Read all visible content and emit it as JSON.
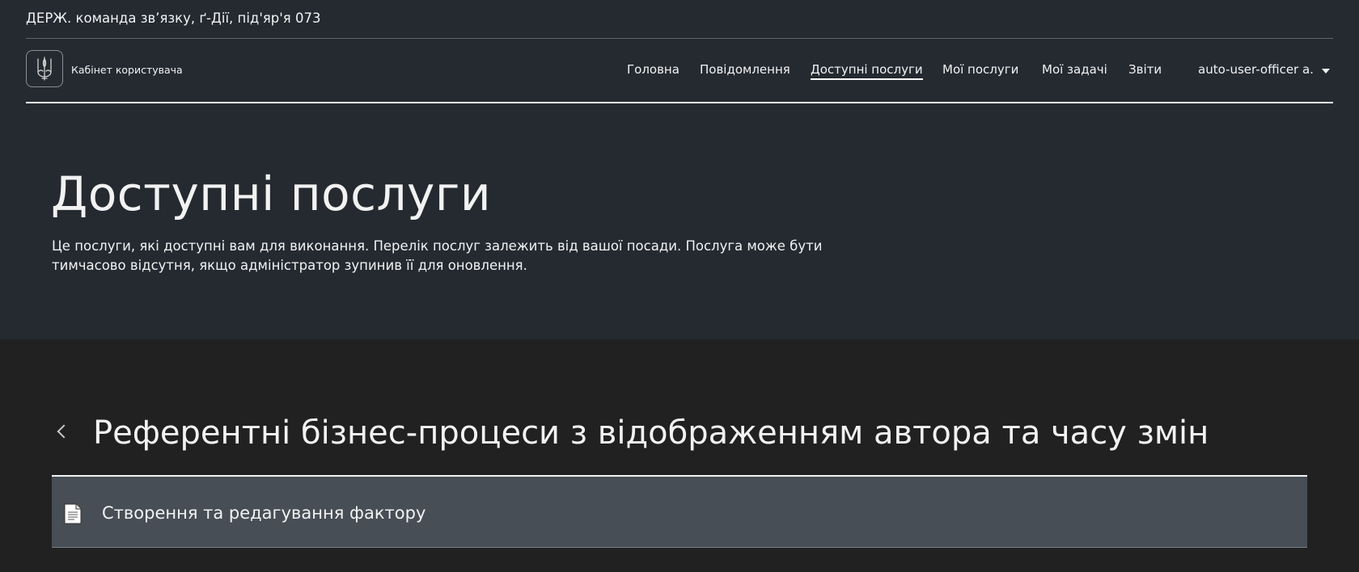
{
  "org": {
    "name": "ДЕРЖ. команда зв’язку, ґ-Дії, під'яр'я 073"
  },
  "header": {
    "logo_icon": "trident-icon",
    "cabinet_title": "Кабінет користувача",
    "nav": [
      {
        "label": "Головна"
      },
      {
        "label": "Повідомлення"
      },
      {
        "label": "Доступні послуги",
        "active": true
      },
      {
        "label": "Мої послуги"
      },
      {
        "label": "Мої задачі"
      },
      {
        "label": "Звіти"
      }
    ],
    "user": {
      "label": "auto-user-officer a.",
      "icon": "caret-down-icon"
    }
  },
  "hero": {
    "title": "Доступні послуги",
    "description": "Це послуги, які доступні вам для виконання. Перелік послуг залежить від вашої посади. Послуга може бути тимчасово відсутня, якщо адміністратор зупинив її для оновлення."
  },
  "group": {
    "back_icon": "chevron-left-icon",
    "title": "Референтні бізнес-процеси з відображенням автора та часу змін",
    "services": [
      {
        "label": "Створення та редагування фактору",
        "icon": "document-icon"
      }
    ]
  },
  "colors": {
    "header_bg": "#252a31",
    "page_bg": "#212121",
    "row_bg": "#474e55",
    "text": "#f2f2f2"
  }
}
